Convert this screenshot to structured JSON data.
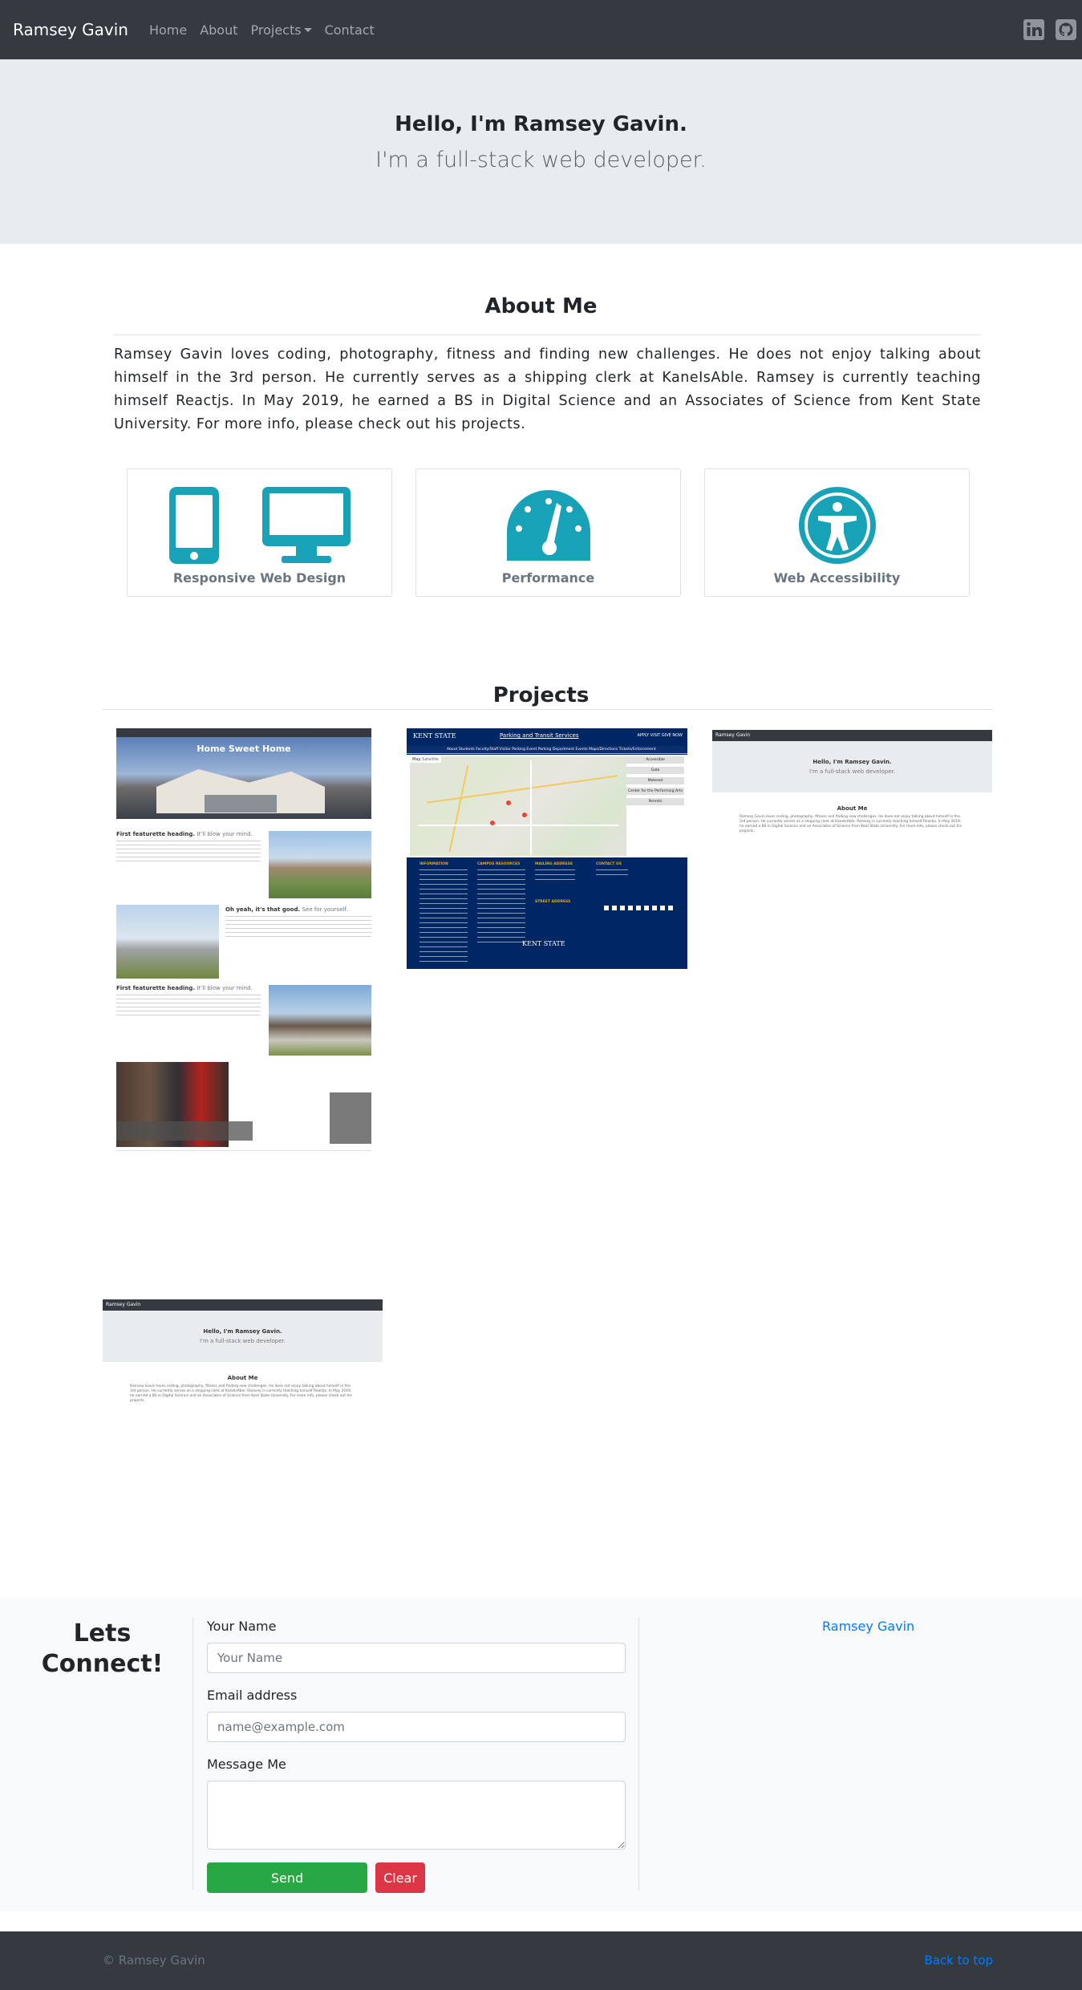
{
  "navbar": {
    "brand": "Ramsey Gavin",
    "links": [
      "Home",
      "About",
      "Projects",
      "Contact"
    ],
    "icons": [
      "linkedin-icon",
      "github-icon"
    ]
  },
  "hero": {
    "title": "Hello, I'm Ramsey Gavin.",
    "subtitle": "I'm a full-stack web developer."
  },
  "about": {
    "title": "About Me",
    "text": "Ramsey Gavin loves coding, photography, fitness and finding new challenges. He does not enjoy talking about himself in the 3rd person. He currently serves as a shipping clerk at KaneIsAble. Ramsey is currently teaching himself Reactjs. In May 2019, he earned a BS in Digital Science and an Associates of Science from Kent State University. For more info, please check out his projects.",
    "cards": [
      {
        "label": "Responsive Web Design",
        "icons": [
          "mobile-icon",
          "desktop-icon"
        ]
      },
      {
        "label": "Performance",
        "icons": [
          "tachometer-icon"
        ]
      },
      {
        "label": "Web Accessibility",
        "icons": [
          "universal-access-icon"
        ]
      }
    ]
  },
  "projects": {
    "title": "Projects",
    "home_sweet_home": {
      "title": "Home Sweet Home",
      "feature1": "First featurette heading.",
      "feature1_muted": "It'll blow your mind.",
      "feature2": "Oh yeah, it's that good.",
      "feature2_muted": "See for yourself.",
      "feature3": "First featurette heading.",
      "feature3_muted": "It'll blow your mind."
    },
    "kent_state": {
      "logo": "KENT STATE",
      "header_link": "Parking and Transit Services",
      "phone": "APPLY VISIT GIVE NOW",
      "nav": [
        "About",
        "Students",
        "Faculty/Staff",
        "Visitor Parking",
        "Event Parking",
        "Department Events",
        "Maps/Directions",
        "Tickets/Enforcement"
      ],
      "map_tabs": [
        "Map",
        "Satellite"
      ],
      "sidebar_buttons": [
        "Accessible",
        "Gate",
        "Metered",
        "Center for the Performing Arts",
        "Permits"
      ],
      "footer_headings": [
        "INFORMATION",
        "CAMPUS RESOURCES",
        "MAILING ADDRESS",
        "CONTACT US",
        "STREET ADDRESS"
      ],
      "footer_logo": "KENT STATE"
    },
    "portfolio": {
      "brand": "Ramsey Gavin",
      "hero_title": "Hello, I'm Ramsey Gavin.",
      "hero_subtitle": "I'm a full-stack web developer.",
      "about_title": "About Me",
      "about_text": "Ramsey Gavin loves coding, photography, fitness and finding new challenges. He does not enjoy talking about himself in the 3rd person. He currently serves as a shipping clerk at KaneIsAble. Ramsey is currently teaching himself Reactjs. In May 2019, he earned a BS in Digital Science and an Associates of Science from Kent State University. For more info, please check out his projects."
    }
  },
  "contact": {
    "heading": "Lets Connect!",
    "name_label": "Your Name",
    "name_placeholder": "Your Name",
    "email_label": "Email address",
    "email_placeholder": "name@example.com",
    "message_label": "Message Me",
    "send_label": "Send",
    "clear_label": "Clear",
    "side_link": "Ramsey Gavin"
  },
  "footer": {
    "copyright": "© Ramsey Gavin",
    "back_to_top": "Back to top"
  },
  "colors": {
    "navbar": "#343a40",
    "jumbotron": "#e9ecef",
    "icon_teal": "#17a2b8",
    "send": "#28a745",
    "clear": "#dc3545",
    "link": "#007bff",
    "kent_navy": "#002664",
    "kent_gold": "#eaab00"
  }
}
